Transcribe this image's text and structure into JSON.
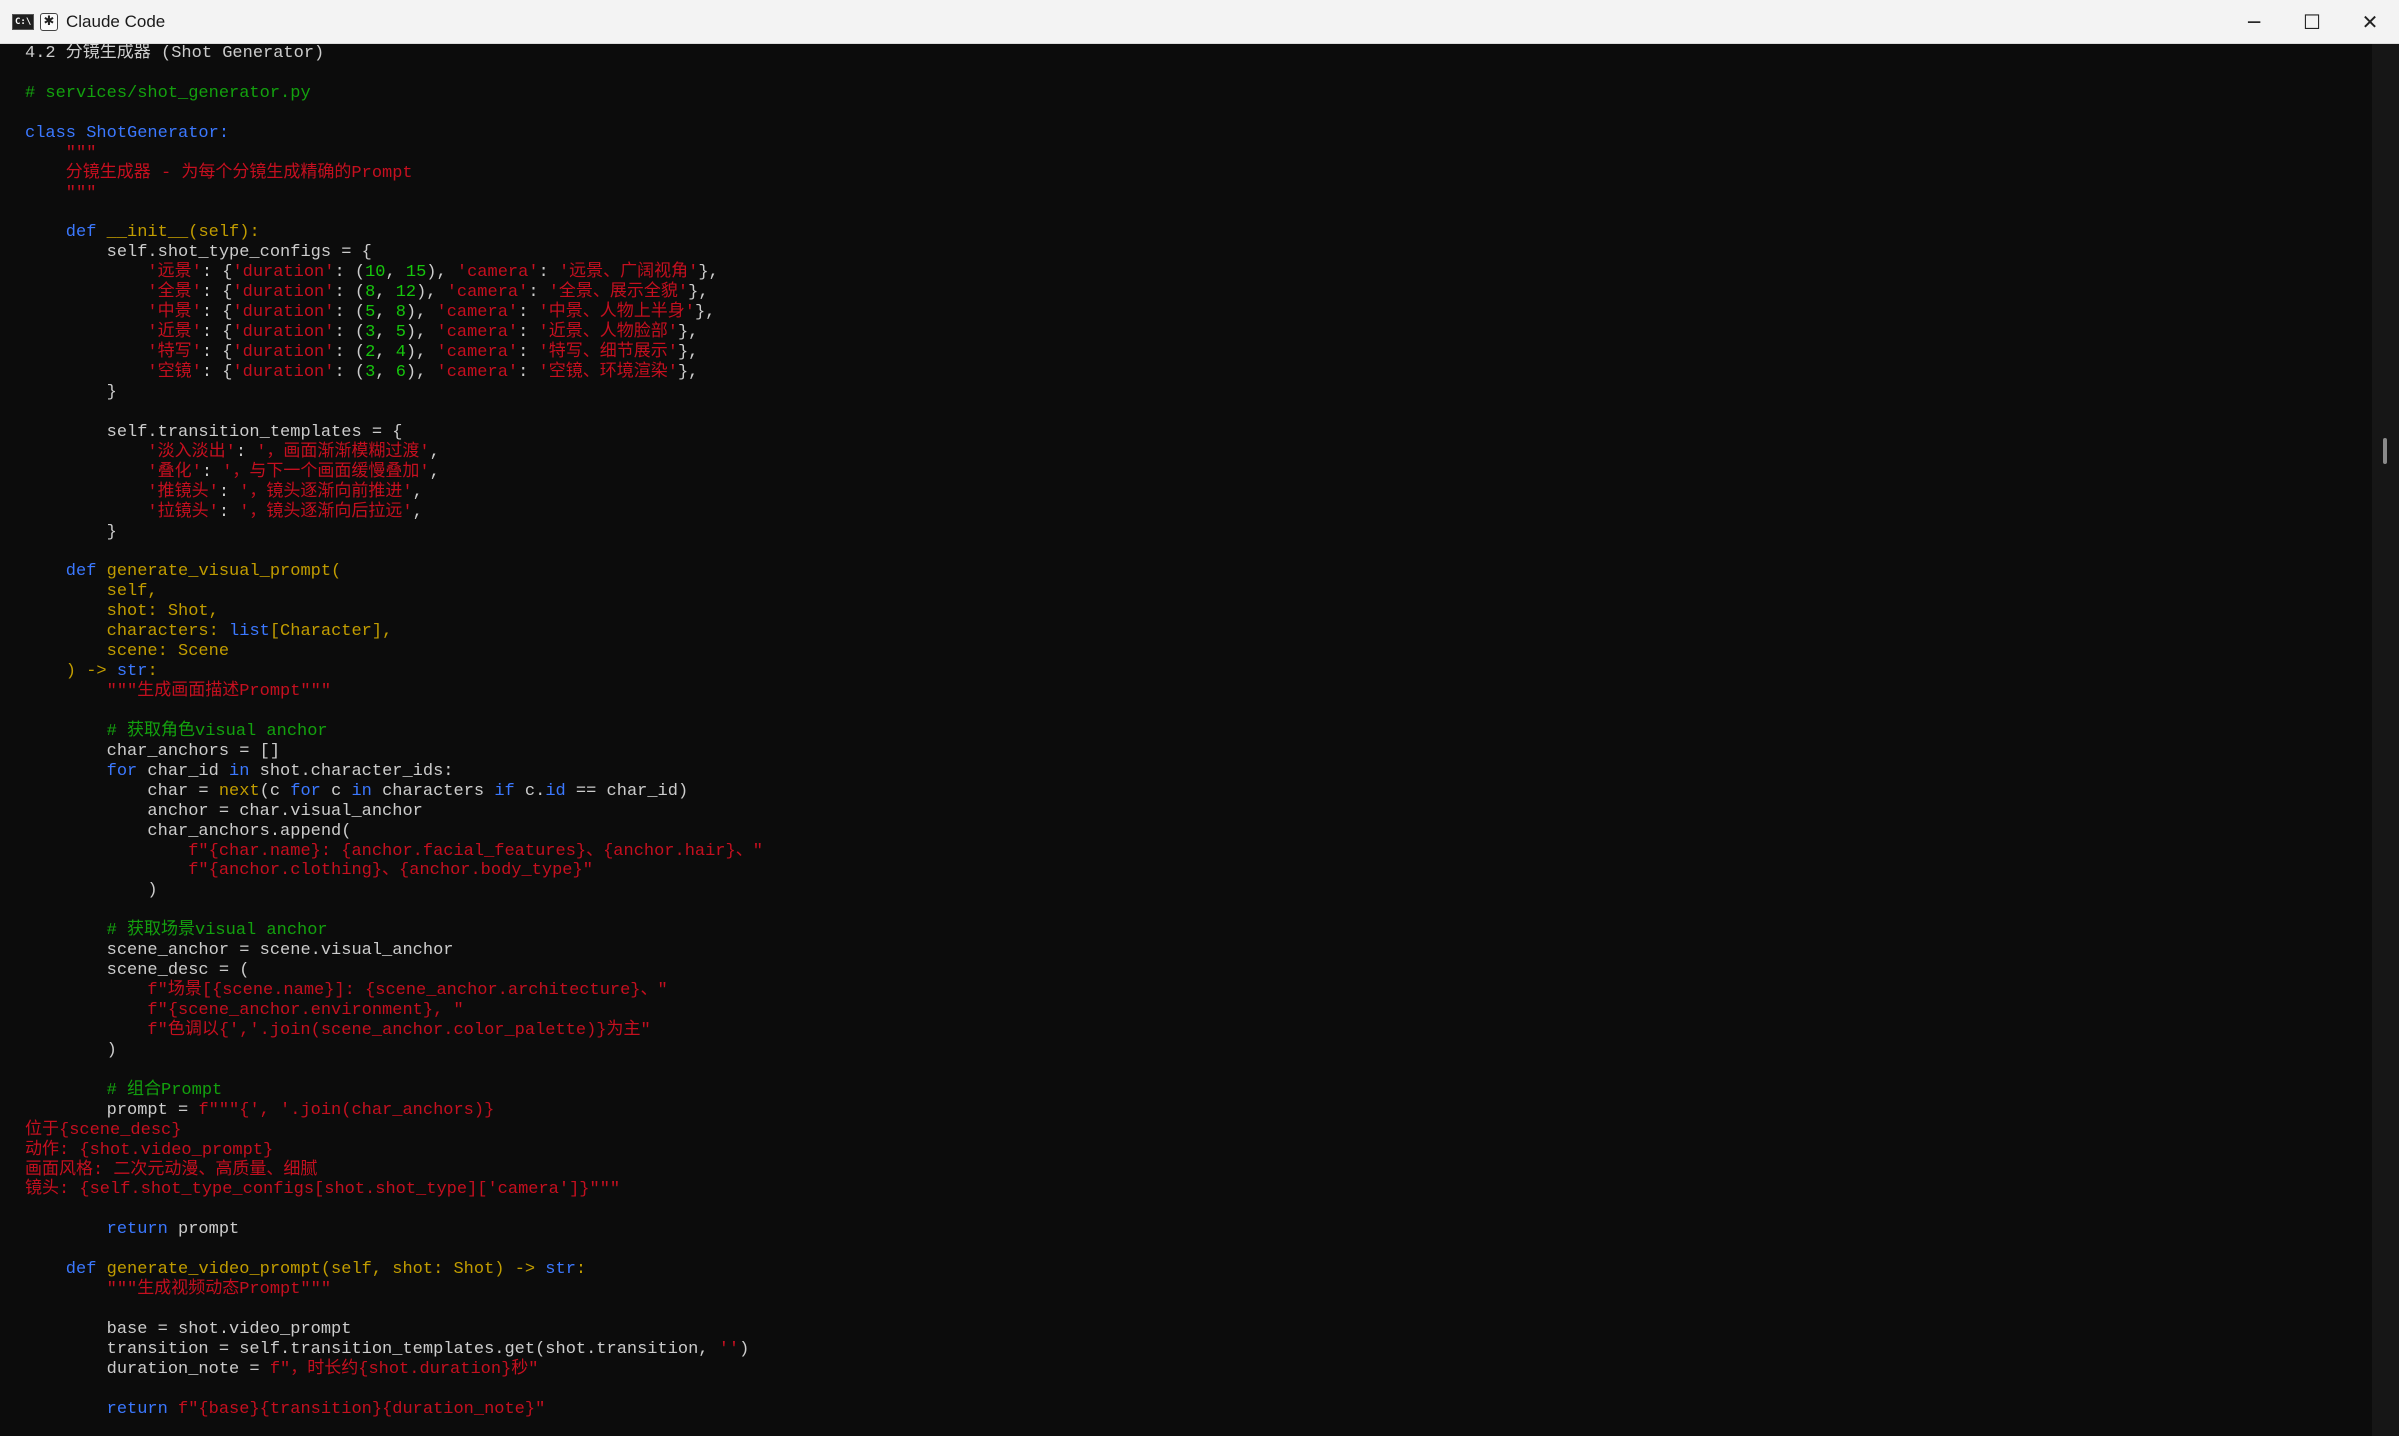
{
  "window": {
    "title": "Claude Code",
    "icons": {
      "terminal": "cmd-icon",
      "app": "asterisk-icon"
    },
    "controls": [
      {
        "name": "minimize-button",
        "glyph": "─"
      },
      {
        "name": "maximize-button",
        "glyph": "☐"
      },
      {
        "name": "close-button",
        "glyph": "✕"
      }
    ]
  },
  "colors": {
    "background": "#0c0c0c",
    "keyword": "#3b78ff",
    "identifier": "#c19c00",
    "string": "#c50f1f",
    "comment": "#13a10e",
    "number": "#16c60c",
    "text": "#cccccc"
  },
  "code_lines": [
    [
      [
        "plain",
        "4.2 分镜生成器 (Shot Generator)"
      ]
    ],
    [],
    [
      [
        "cmt",
        "# services/shot_generator.py"
      ]
    ],
    [],
    [
      [
        "def",
        "class ShotGenerator:"
      ]
    ],
    [
      [
        "str",
        "    \"\"\""
      ]
    ],
    [
      [
        "str",
        "    分镜生成器 - 为每个分镜生成精确的Prompt"
      ]
    ],
    [
      [
        "str",
        "    \"\"\""
      ]
    ],
    [],
    [
      [
        "def",
        "    def "
      ],
      [
        "name",
        "__init__(self):"
      ]
    ],
    [
      [
        "plain",
        "        self.shot_type_configs = {"
      ]
    ],
    [
      [
        "str",
        "            '远景'"
      ],
      [
        "plain",
        ": {"
      ],
      [
        "str",
        "'duration'"
      ],
      [
        "plain",
        ": ("
      ],
      [
        "num",
        "10"
      ],
      [
        "plain",
        ", "
      ],
      [
        "num",
        "15"
      ],
      [
        "plain",
        "), "
      ],
      [
        "str",
        "'camera'"
      ],
      [
        "plain",
        ": "
      ],
      [
        "str",
        "'远景、广阔视角'"
      ],
      [
        "plain",
        "},"
      ]
    ],
    [
      [
        "str",
        "            '全景'"
      ],
      [
        "plain",
        ": {"
      ],
      [
        "str",
        "'duration'"
      ],
      [
        "plain",
        ": ("
      ],
      [
        "num",
        "8"
      ],
      [
        "plain",
        ", "
      ],
      [
        "num",
        "12"
      ],
      [
        "plain",
        "), "
      ],
      [
        "str",
        "'camera'"
      ],
      [
        "plain",
        ": "
      ],
      [
        "str",
        "'全景、展示全貌'"
      ],
      [
        "plain",
        "},"
      ]
    ],
    [
      [
        "str",
        "            '中景'"
      ],
      [
        "plain",
        ": {"
      ],
      [
        "str",
        "'duration'"
      ],
      [
        "plain",
        ": ("
      ],
      [
        "num",
        "5"
      ],
      [
        "plain",
        ", "
      ],
      [
        "num",
        "8"
      ],
      [
        "plain",
        "), "
      ],
      [
        "str",
        "'camera'"
      ],
      [
        "plain",
        ": "
      ],
      [
        "str",
        "'中景、人物上半身'"
      ],
      [
        "plain",
        "},"
      ]
    ],
    [
      [
        "str",
        "            '近景'"
      ],
      [
        "plain",
        ": {"
      ],
      [
        "str",
        "'duration'"
      ],
      [
        "plain",
        ": ("
      ],
      [
        "num",
        "3"
      ],
      [
        "plain",
        ", "
      ],
      [
        "num",
        "5"
      ],
      [
        "plain",
        "), "
      ],
      [
        "str",
        "'camera'"
      ],
      [
        "plain",
        ": "
      ],
      [
        "str",
        "'近景、人物脸部'"
      ],
      [
        "plain",
        "},"
      ]
    ],
    [
      [
        "str",
        "            '特写'"
      ],
      [
        "plain",
        ": {"
      ],
      [
        "str",
        "'duration'"
      ],
      [
        "plain",
        ": ("
      ],
      [
        "num",
        "2"
      ],
      [
        "plain",
        ", "
      ],
      [
        "num",
        "4"
      ],
      [
        "plain",
        "), "
      ],
      [
        "str",
        "'camera'"
      ],
      [
        "plain",
        ": "
      ],
      [
        "str",
        "'特写、细节展示'"
      ],
      [
        "plain",
        "},"
      ]
    ],
    [
      [
        "str",
        "            '空镜'"
      ],
      [
        "plain",
        ": {"
      ],
      [
        "str",
        "'duration'"
      ],
      [
        "plain",
        ": ("
      ],
      [
        "num",
        "3"
      ],
      [
        "plain",
        ", "
      ],
      [
        "num",
        "6"
      ],
      [
        "plain",
        "), "
      ],
      [
        "str",
        "'camera'"
      ],
      [
        "plain",
        ": "
      ],
      [
        "str",
        "'空镜、环境渲染'"
      ],
      [
        "plain",
        "},"
      ]
    ],
    [
      [
        "plain",
        "        }"
      ]
    ],
    [],
    [
      [
        "plain",
        "        self.transition_templates = {"
      ]
    ],
    [
      [
        "str",
        "            '淡入淡出'"
      ],
      [
        "plain",
        ": "
      ],
      [
        "str",
        "'，画面渐渐模糊过渡'"
      ],
      [
        "plain",
        ","
      ]
    ],
    [
      [
        "str",
        "            '叠化'"
      ],
      [
        "plain",
        ": "
      ],
      [
        "str",
        "'，与下一个画面缓慢叠加'"
      ],
      [
        "plain",
        ","
      ]
    ],
    [
      [
        "str",
        "            '推镜头'"
      ],
      [
        "plain",
        ": "
      ],
      [
        "str",
        "'，镜头逐渐向前推进'"
      ],
      [
        "plain",
        ","
      ]
    ],
    [
      [
        "str",
        "            '拉镜头'"
      ],
      [
        "plain",
        ": "
      ],
      [
        "str",
        "'，镜头逐渐向后拉远'"
      ],
      [
        "plain",
        ","
      ]
    ],
    [
      [
        "plain",
        "        }"
      ]
    ],
    [],
    [
      [
        "def",
        "    def "
      ],
      [
        "name",
        "generate_visual_prompt("
      ]
    ],
    [
      [
        "name",
        "        self,"
      ]
    ],
    [
      [
        "name",
        "        shot: Shot,"
      ]
    ],
    [
      [
        "name",
        "        characters: "
      ],
      [
        "def",
        "list"
      ],
      [
        "name",
        "[Character],"
      ]
    ],
    [
      [
        "name",
        "        scene: Scene"
      ]
    ],
    [
      [
        "name",
        "    ) -> "
      ],
      [
        "def",
        "str"
      ],
      [
        "name",
        ":"
      ]
    ],
    [
      [
        "str",
        "        \"\"\"生成画面描述Prompt\"\"\""
      ]
    ],
    [],
    [
      [
        "cmt",
        "        # 获取角色visual anchor"
      ]
    ],
    [
      [
        "plain",
        "        char_anchors = []"
      ]
    ],
    [
      [
        "def",
        "        for "
      ],
      [
        "plain",
        "char_id "
      ],
      [
        "def",
        "in "
      ],
      [
        "plain",
        "shot.character_ids:"
      ]
    ],
    [
      [
        "plain",
        "            char = "
      ],
      [
        "name",
        "next"
      ],
      [
        "plain",
        "(c "
      ],
      [
        "def",
        "for "
      ],
      [
        "plain",
        "c "
      ],
      [
        "def",
        "in "
      ],
      [
        "plain",
        "characters "
      ],
      [
        "def",
        "if "
      ],
      [
        "plain",
        "c."
      ],
      [
        "def",
        "id"
      ],
      [
        "plain",
        " == char_id)"
      ]
    ],
    [
      [
        "plain",
        "            anchor = char.visual_anchor"
      ]
    ],
    [
      [
        "plain",
        "            char_anchors.append("
      ]
    ],
    [
      [
        "str",
        "                f\"{char.name}: {anchor.facial_features}、{anchor.hair}、\""
      ]
    ],
    [
      [
        "str",
        "                f\"{anchor.clothing}、{anchor.body_type}\""
      ]
    ],
    [
      [
        "plain",
        "            )"
      ]
    ],
    [],
    [
      [
        "cmt",
        "        # 获取场景visual anchor"
      ]
    ],
    [
      [
        "plain",
        "        scene_anchor = scene.visual_anchor"
      ]
    ],
    [
      [
        "plain",
        "        scene_desc = ("
      ]
    ],
    [
      [
        "str",
        "            f\"场景[{scene.name}]: {scene_anchor.architecture}、\""
      ]
    ],
    [
      [
        "str",
        "            f\"{scene_anchor.environment}, \""
      ]
    ],
    [
      [
        "str",
        "            f\"色调以{','.join(scene_anchor.color_palette)}为主\""
      ]
    ],
    [
      [
        "plain",
        "        )"
      ]
    ],
    [],
    [
      [
        "cmt",
        "        # 组合Prompt"
      ]
    ],
    [
      [
        "plain",
        "        prompt = "
      ],
      [
        "str",
        "f\"\"\"{', '.join(char_anchors)}"
      ]
    ],
    [
      [
        "str",
        "位于{scene_desc}"
      ]
    ],
    [
      [
        "str",
        "动作: {shot.video_prompt}"
      ]
    ],
    [
      [
        "str",
        "画面风格: 二次元动漫、高质量、细腻"
      ]
    ],
    [
      [
        "str",
        "镜头: {self.shot_type_configs[shot.shot_type]['camera']}\"\"\""
      ]
    ],
    [],
    [
      [
        "def",
        "        return "
      ],
      [
        "plain",
        "prompt"
      ]
    ],
    [],
    [
      [
        "def",
        "    def "
      ],
      [
        "name",
        "generate_video_prompt(self, shot: Shot) -> "
      ],
      [
        "def",
        "str"
      ],
      [
        "name",
        ":"
      ]
    ],
    [
      [
        "str",
        "        \"\"\"生成视频动态Prompt\"\"\""
      ]
    ],
    [],
    [
      [
        "plain",
        "        base = shot.video_prompt"
      ]
    ],
    [
      [
        "plain",
        "        transition = self.transition_templates.get(shot.transition, "
      ],
      [
        "str",
        "''"
      ],
      [
        "plain",
        ")"
      ]
    ],
    [
      [
        "plain",
        "        duration_note = "
      ],
      [
        "str",
        "f\"，时长约{shot.duration}秒\""
      ]
    ],
    [],
    [
      [
        "def",
        "        return "
      ],
      [
        "str",
        "f\"{base}{transition}{duration_note}\""
      ]
    ]
  ]
}
